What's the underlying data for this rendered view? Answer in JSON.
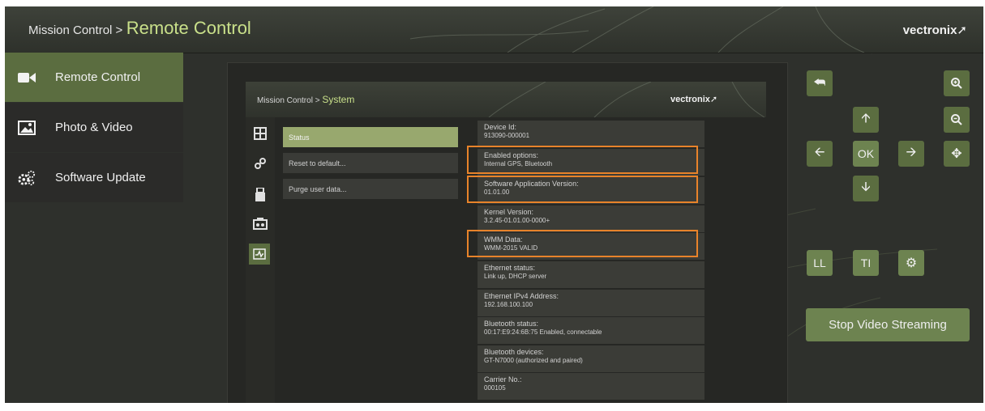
{
  "header": {
    "breadcrumb": "Mission Control >",
    "title": "Remote Control",
    "brand": "vectronix"
  },
  "sidebar": {
    "items": [
      {
        "label": "Remote Control",
        "icon": "video-camera-icon",
        "active": true
      },
      {
        "label": "Photo & Video",
        "icon": "image-icon",
        "active": false
      },
      {
        "label": "Software Update",
        "icon": "gears-icon",
        "active": false
      }
    ]
  },
  "remote": {
    "header": {
      "breadcrumb": "Mission Control >",
      "title": "System",
      "brand": "vectronix"
    },
    "side_icons": [
      "grid-icon",
      "connection-icon",
      "usb-icon",
      "device-icon",
      "system-icon"
    ],
    "menu": [
      {
        "label": "Status",
        "active": true
      },
      {
        "label": "Reset to default...",
        "active": false
      },
      {
        "label": "Purge user data...",
        "active": false
      }
    ],
    "info": [
      {
        "label": "Device Id:",
        "value": "913090-000001",
        "highlighted": false
      },
      {
        "label": "Enabled options:",
        "value": "Internal GPS, Bluetooth",
        "highlighted": true
      },
      {
        "label": "Software Application Version:",
        "value": "01.01.00",
        "highlighted": true
      },
      {
        "label": "Kernel Version:",
        "value": "3.2.45-01.01.00-0000+",
        "highlighted": false
      },
      {
        "label": "WMM Data:",
        "value": "WMM-2015 VALID",
        "highlighted": true
      },
      {
        "label": "Ethernet status:",
        "value": "Link up, DHCP server",
        "highlighted": false
      },
      {
        "label": "Ethernet IPv4 Address:",
        "value": "192.168.100.100",
        "highlighted": false
      },
      {
        "label": "Bluetooth status:",
        "value": "00:17:E9:24:6B:75  Enabled, connectable",
        "highlighted": false
      },
      {
        "label": "Bluetooth devices:",
        "value": "GT-N7000 (authorized and paired)",
        "highlighted": false
      },
      {
        "label": "Carrier No.:",
        "value": "000105",
        "highlighted": false
      }
    ]
  },
  "controls": {
    "ok_label": "OK",
    "ll_label": "LL",
    "ti_label": "TI",
    "stop_video_label": "Stop Video Streaming"
  },
  "colors": {
    "accent": "#5b6d40",
    "accent_light": "#6d8350",
    "highlight": "#e8832a",
    "title_green": "#c9e08a"
  }
}
